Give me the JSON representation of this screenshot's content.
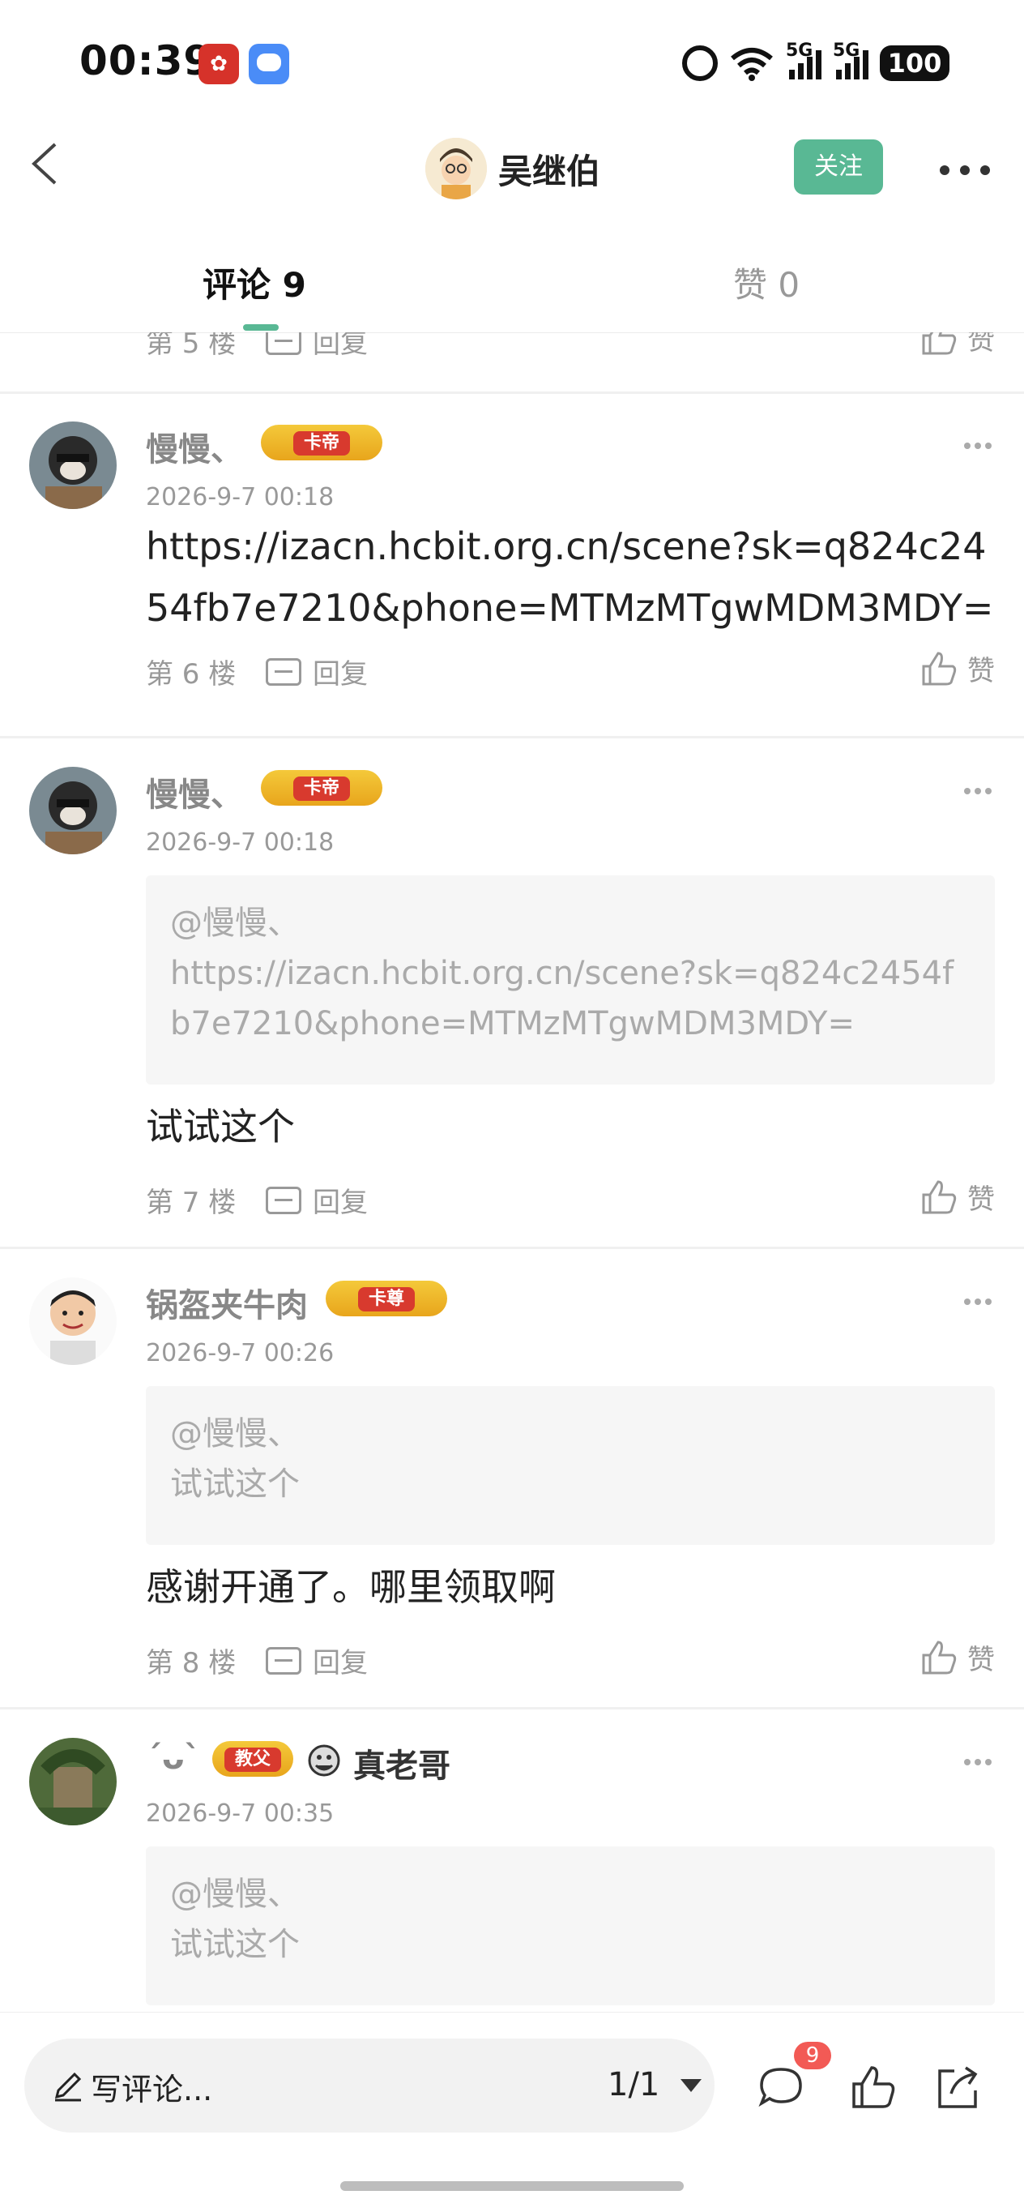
{
  "status": {
    "time": "00:39",
    "battery": "100",
    "net1": "5G",
    "net2": "5G",
    "wifi_num": "6"
  },
  "nav": {
    "name": "吴继伯",
    "follow_label": "关注"
  },
  "tabs": {
    "comments": "评论 9",
    "likes": "赞 0"
  },
  "common": {
    "reply": "回复",
    "like": "赞"
  },
  "prev_floor": {
    "floor": "第 5 楼"
  },
  "comments": [
    {
      "name": "慢慢、",
      "badge": "卡帝",
      "time": "2026-9-7 00:18",
      "text": "https://izacn.hcbit.org.cn/scene?sk=q824c2454fb7e7210&phone=MTMzMTgwMDM3MDY=",
      "floor": "第 6 楼"
    },
    {
      "name": "慢慢、",
      "badge": "卡帝",
      "time": "2026-9-7 00:18",
      "quote_user": "@慢慢、",
      "quote_text": "https://izacn.hcbit.org.cn/scene?sk=q824c2454fb7e7210&phone=MTMzMTgwMDM3MDY=",
      "text": "试试这个",
      "floor": "第 7 楼"
    },
    {
      "name": "锅盔夹牛肉",
      "badge": "卡尊",
      "time": "2026-9-7 00:26",
      "quote_user": "@慢慢、",
      "quote_text": "试试这个",
      "text": "感谢开通了。哪里领取啊",
      "floor": "第 8 楼"
    },
    {
      "name": "´ᴗ`",
      "badge": "教父",
      "name_suffix": "真老哥",
      "time": "2026-9-7 00:35",
      "quote_user": "@慢慢、",
      "quote_text": "试试这个"
    }
  ],
  "bottom": {
    "placeholder": "写评论...",
    "pager": "1/1",
    "comment_count": "9"
  }
}
